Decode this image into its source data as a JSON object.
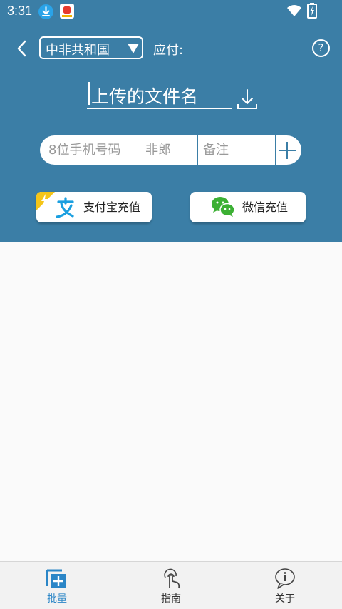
{
  "status_bar": {
    "time": "3:31",
    "icons": [
      "download-notification-icon",
      "app-notification-icon",
      "wifi-icon",
      "battery-charging-icon"
    ]
  },
  "header": {
    "country": "中非共和国",
    "pay_label": "应付:",
    "back_icon": "chevron-left-icon",
    "dropdown_icon": "triangle-down-icon",
    "help_icon": "question-mark-icon",
    "help_glyph": "?"
  },
  "file": {
    "placeholder": "上传的文件名",
    "download_icon": "download-icon"
  },
  "entry": {
    "phone_placeholder": "8位手机号码",
    "name_placeholder": "非郎",
    "note_placeholder": "备注",
    "add_icon": "plus-icon"
  },
  "recharge": {
    "alipay_label": "支付宝充值",
    "wechat_label": "微信充值"
  },
  "nav": {
    "items": [
      {
        "label": "批量",
        "icon": "batch-add-icon",
        "active": true
      },
      {
        "label": "指南",
        "icon": "touch-guide-icon",
        "active": false
      },
      {
        "label": "关于",
        "icon": "info-icon",
        "active": false
      }
    ]
  },
  "colors": {
    "header_bg": "#3b7ea6",
    "content_bg": "#fafafa",
    "nav_active": "#2b86c7",
    "alipay_blue": "#1a9fe0",
    "wechat_green": "#3cb034"
  }
}
